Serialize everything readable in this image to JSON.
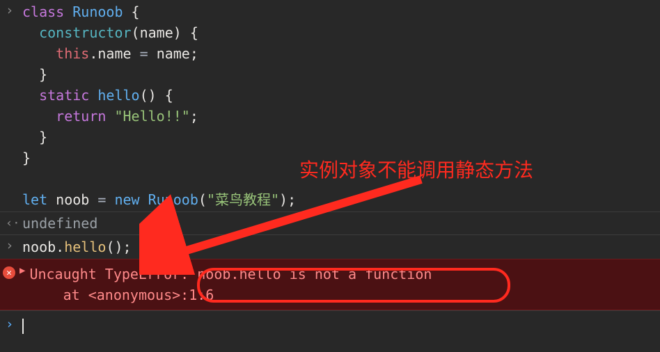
{
  "input1": {
    "line1_class": "class",
    "line1_name": "Runoob",
    "line1_brace": " {",
    "line2_constructor": "constructor",
    "line2_params": "(name) {",
    "line3_this": "this",
    "line3_dot": ".",
    "line3_prop": "name",
    "line3_eq": " = ",
    "line3_rhs": "name",
    "line3_semi": ";",
    "line4_brace": "}",
    "line5_static": "static",
    "line5_fn": "hello",
    "line5_paren": "() {",
    "line6_return": "return",
    "line6_str": "\"Hello!!\"",
    "line6_semi": ";",
    "line7_brace": "}",
    "line8_brace": "}",
    "line10_let": "let",
    "line10_var": "noob",
    "line10_eq": " = ",
    "line10_new": "new",
    "line10_cls": "Runoob",
    "line10_open": "(",
    "line10_arg": "\"菜鸟教程\"",
    "line10_close": ");"
  },
  "output1": "undefined",
  "input2": {
    "obj": "noob",
    "dot": ".",
    "method": "hello",
    "paren": "();"
  },
  "error": {
    "line1": "Uncaught TypeError: noob.hello is not a function",
    "line2": "    at <anonymous>:1:6"
  },
  "annotation": "实例对象不能调用静态方法"
}
